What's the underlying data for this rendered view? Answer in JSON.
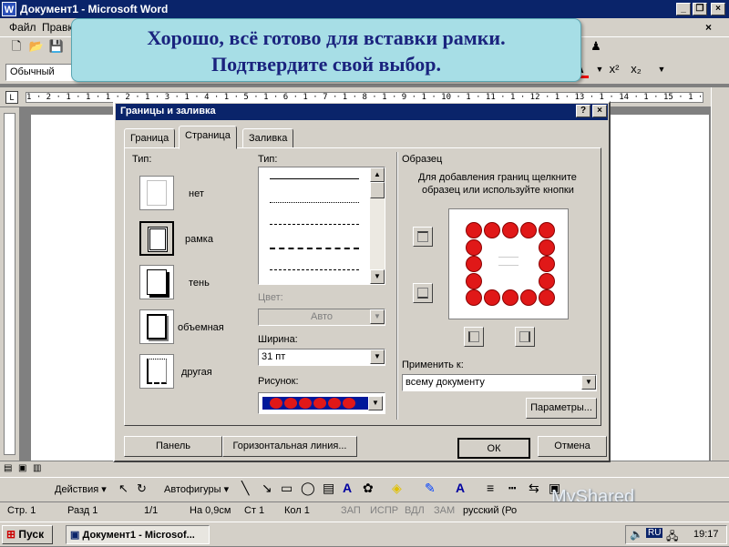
{
  "window": {
    "title": "Документ1 - Microsoft Word",
    "app_icon": "W"
  },
  "menu": {
    "file": "Файл",
    "edit": "Правка"
  },
  "format_toolbar": {
    "style": "Обычный",
    "superscript": "x²",
    "subscript": "x₂"
  },
  "ruler": {
    "text": "1 · 2 · 1 · 1 · 1 · 2 · 1 · 3 · 1 · 4 · 1 · 5 · 1 · 6 · 1 · 7 · 1 · 8 · 1 · 9 · 1 · 10 · 1 · 11 · 1 · 12 · 1 · 13 · 1 · 14 · 1 · 15 · 1 · 16 · 1 · 17 · 1 · 18 · 1 · 19 · 1 · 20 · 1 · 21 · 1 · 22 · 1 · 23 · 1 · 24 · 1 · 25 · 1 · 26 · 1 · 27 · 1 · 28 ·"
  },
  "callout": {
    "line1": "Хорошо, всё готово для вставки рамки.",
    "line2": "Подтвердите свой выбор."
  },
  "dialog": {
    "title": "Границы и заливка",
    "help": "?",
    "close": "×",
    "tabs": [
      "Граница",
      "Страница",
      "Заливка"
    ],
    "type_label": "Тип:",
    "types": [
      "нет",
      "рамка",
      "тень",
      "объемная",
      "другая"
    ],
    "style_label": "Тип:",
    "color_label": "Цвет:",
    "color_value": "Авто",
    "width_label": "Ширина:",
    "width_value": "31 пт",
    "art_label": "Рисунок:",
    "preview_label": "Образец",
    "preview_hint_1": "Для добавления границ щелкните",
    "preview_hint_2": "образец или используйте кнопки",
    "apply_label": "Применить к:",
    "apply_value": "всему документу",
    "options_button": "Параметры...",
    "panel_button": "Панель",
    "hline_button": "Горизонтальная линия...",
    "ok_button": "ОК",
    "cancel_button": "Отмена"
  },
  "drawing_toolbar": {
    "actions": "Действия ▾",
    "autoshapes": "Автофигуры ▾"
  },
  "status": {
    "page": "Стр. 1",
    "section": "Разд 1",
    "pages": "1/1",
    "at": "На 0,9см",
    "line": "Ст 1",
    "col": "Кол 1",
    "rec": "ЗАП",
    "trk": "ИСПР",
    "ext": "ВДЛ",
    "ovr": "ЗАМ",
    "lang": "русский (Ро"
  },
  "taskbar": {
    "start": "Пуск",
    "task": "Документ1 - Microsof...",
    "lang": "RU",
    "time": "19:17"
  },
  "watermark": "MyShared",
  "colors": {
    "titlebar": "#0a246a",
    "callout": "#a7dee6",
    "callout_text": "#1a237e",
    "chrome": "#d4d0c8",
    "apple": "#e01818",
    "art_bg": "#00189a"
  }
}
